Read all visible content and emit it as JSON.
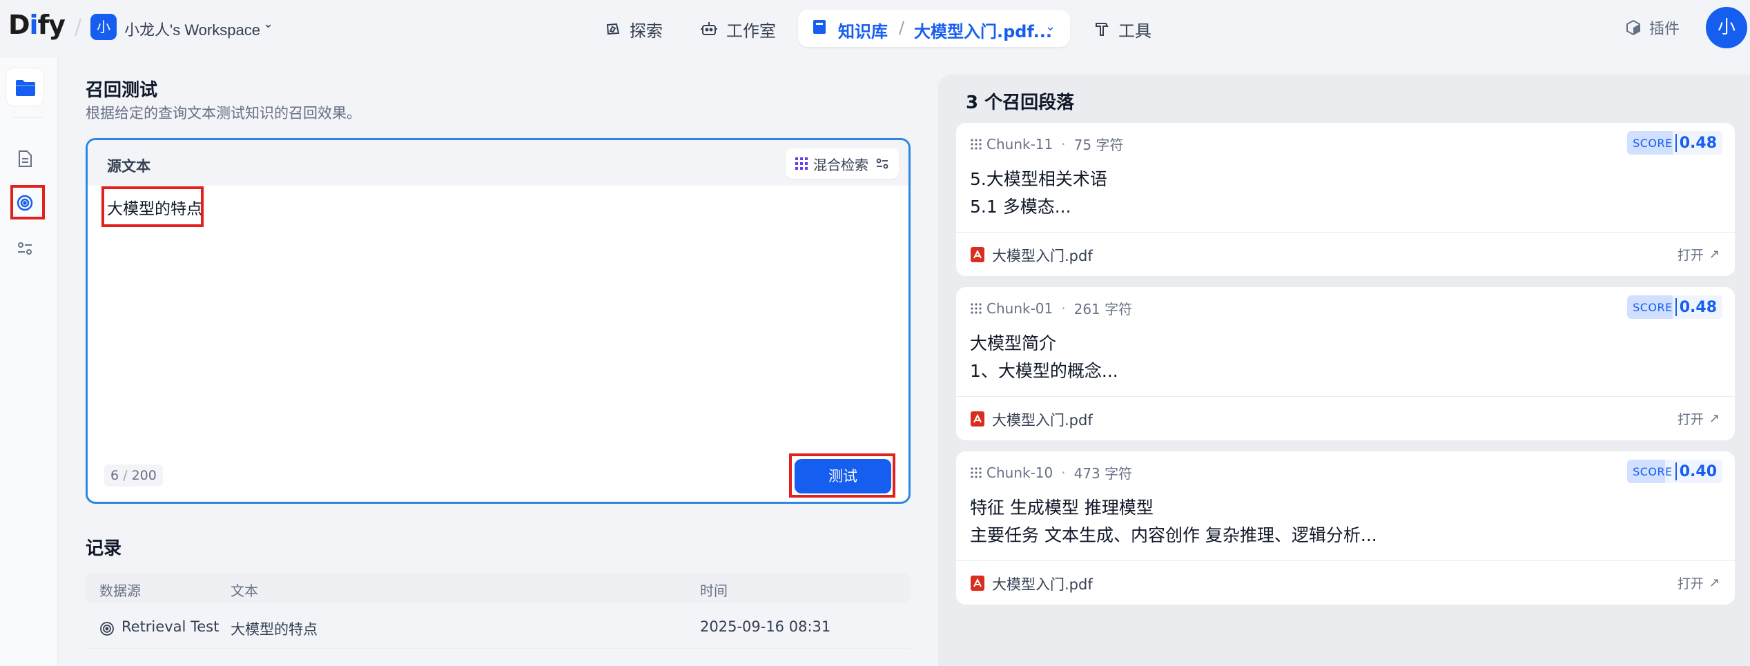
{
  "app": {
    "logo_pre": "D",
    "logo_i": "i",
    "logo_post": "fy",
    "workspace_avatar": "小",
    "workspace_name": "小龙人's Workspace",
    "user_avatar": "小",
    "brand_color": "#155eef"
  },
  "nav": {
    "explore": "探索",
    "studio": "工作室",
    "knowledge": "知识库",
    "current_dataset": "大模型入门.pdf...",
    "tools": "工具",
    "plugins": "插件"
  },
  "retrieval": {
    "title": "召回测试",
    "subtitle": "根据给定的查询文本测试知识的召回效果。",
    "source_label": "源文本",
    "method": "混合检索",
    "query": "大模型的特点",
    "char_count": "6",
    "char_sep": "/",
    "char_limit": "200",
    "test_button": "测试"
  },
  "records": {
    "title": "记录",
    "columns": [
      "数据源",
      "文本",
      "时间"
    ],
    "rows": [
      {
        "source": "Retrieval Test",
        "text": "大模型的特点",
        "time": "2025-09-16 08:31"
      }
    ]
  },
  "results": {
    "title": "3 个召回段落",
    "score_label": "SCORE",
    "open_label": "打开",
    "chunks": [
      {
        "id": "Chunk-11",
        "chars": "75 字符",
        "score": "0.48",
        "score_fraction": 0.48,
        "line1": "5.大模型相关术语",
        "line2": "5.1 多模态...",
        "file": "大模型入门.pdf"
      },
      {
        "id": "Chunk-01",
        "chars": "261 字符",
        "score": "0.48",
        "score_fraction": 0.48,
        "line1": "大模型简介",
        "line2": "1、大模型的概念...",
        "file": "大模型入门.pdf"
      },
      {
        "id": "Chunk-10",
        "chars": "473 字符",
        "score": "0.40",
        "score_fraction": 0.4,
        "line1": "特征 生成模型 推理模型",
        "line2": "主要任务 文本生成、内容创作 复杂推理、逻辑分析...",
        "file": "大模型入门.pdf"
      }
    ]
  }
}
